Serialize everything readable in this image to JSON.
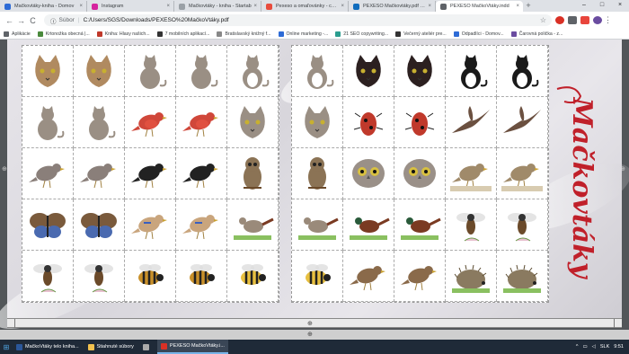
{
  "tabs": [
    {
      "label": "Mačkovtáky-kniha - Domov",
      "color": "#2d6bd6",
      "active": false
    },
    {
      "label": "Instagram",
      "color": "#d6249f",
      "active": false
    },
    {
      "label": "Mačkovtáky - kniha - Startab",
      "color": "#9aa0a6",
      "active": false
    },
    {
      "label": "Pexeso a omaľovánky - cozlio",
      "color": "#e84c3d",
      "active": false
    },
    {
      "label": "PEXESO Mačkovtáky.pdf - On",
      "color": "#0f6cbd",
      "active": false
    },
    {
      "label": "PEXESO MačkoVtáky.indd",
      "color": "#5f6368",
      "active": true
    }
  ],
  "toolbar": {
    "back": "←",
    "forward": "→",
    "reload": "C",
    "origin_label": "Súbor",
    "url": "C:/Users/SGS/Downloads/PEXESO%20MačkoVtáky.pdf",
    "star": "☆"
  },
  "bookmarks": [
    {
      "label": "Aplikácie",
      "color": "#5f6368"
    },
    {
      "label": "Krtonožka obecná |...",
      "color": "#4a8a3c"
    },
    {
      "label": "Kniha: Hlasy našich...",
      "color": "#c0392b"
    },
    {
      "label": "7 mobilních aplikací...",
      "color": "#333333"
    },
    {
      "label": "Bratislavský knižný f...",
      "color": "#888888"
    },
    {
      "label": "Online marketing -...",
      "color": "#2d6bd6"
    },
    {
      "label": "21 SEO copywriting...",
      "color": "#2a9d8f"
    },
    {
      "label": "Večerný ateliér pre...",
      "color": "#333333"
    },
    {
      "label": "Odpadlíci - Domov...",
      "color": "#2d6bd6"
    },
    {
      "label": "Čarovná polička - z...",
      "color": "#6a4ca0"
    }
  ],
  "viewer": {
    "logo_text": "Mačkovtáky",
    "logo_color": "#c0202a",
    "ruler_mark": "⊕"
  },
  "left_grid": [
    [
      "cat-head",
      "cat-head",
      "cat-gray",
      "cat-gray",
      "cat-calico"
    ],
    [
      "cat-tabby",
      "cat-tabby",
      "bullfinch",
      "bullfinch",
      "cat-gray-face"
    ],
    [
      "pigeon",
      "pigeon",
      "blackbird",
      "blackbird",
      "owl"
    ],
    [
      "butterfly",
      "butterfly",
      "jay",
      "jay",
      "pheasant-hen"
    ],
    [
      "fly",
      "fly",
      "bee",
      "bee",
      "bumblebee"
    ]
  ],
  "right_grid": [
    [
      "cat-calico",
      "cat-black",
      "cat-black",
      "cat-bw",
      "cat-bw"
    ],
    [
      "cat-gray-face",
      "bug",
      "bug",
      "swift",
      "swift"
    ],
    [
      "owl",
      "owl-face",
      "owl-face",
      "heron",
      "heron"
    ],
    [
      "pheasant-hen",
      "pheasant",
      "pheasant",
      "fly",
      "fly"
    ],
    [
      "bumblebee",
      "sparrow",
      "sparrow",
      "hedgehog",
      "hedgehog"
    ]
  ],
  "taskbar": {
    "items": [
      {
        "label": "MačkoVtáky telo kniha...",
        "color": "#2b579a",
        "active": false
      },
      {
        "label": "Stiahnuté súbory",
        "color": "#f2c14e",
        "active": false
      },
      {
        "label": "",
        "color": "#aaaaaa",
        "active": false
      },
      {
        "label": "PEXESO MačkoVtáky.i...",
        "color": "#d93025",
        "active": true
      }
    ],
    "lang": "SLK",
    "time": "9:51"
  }
}
